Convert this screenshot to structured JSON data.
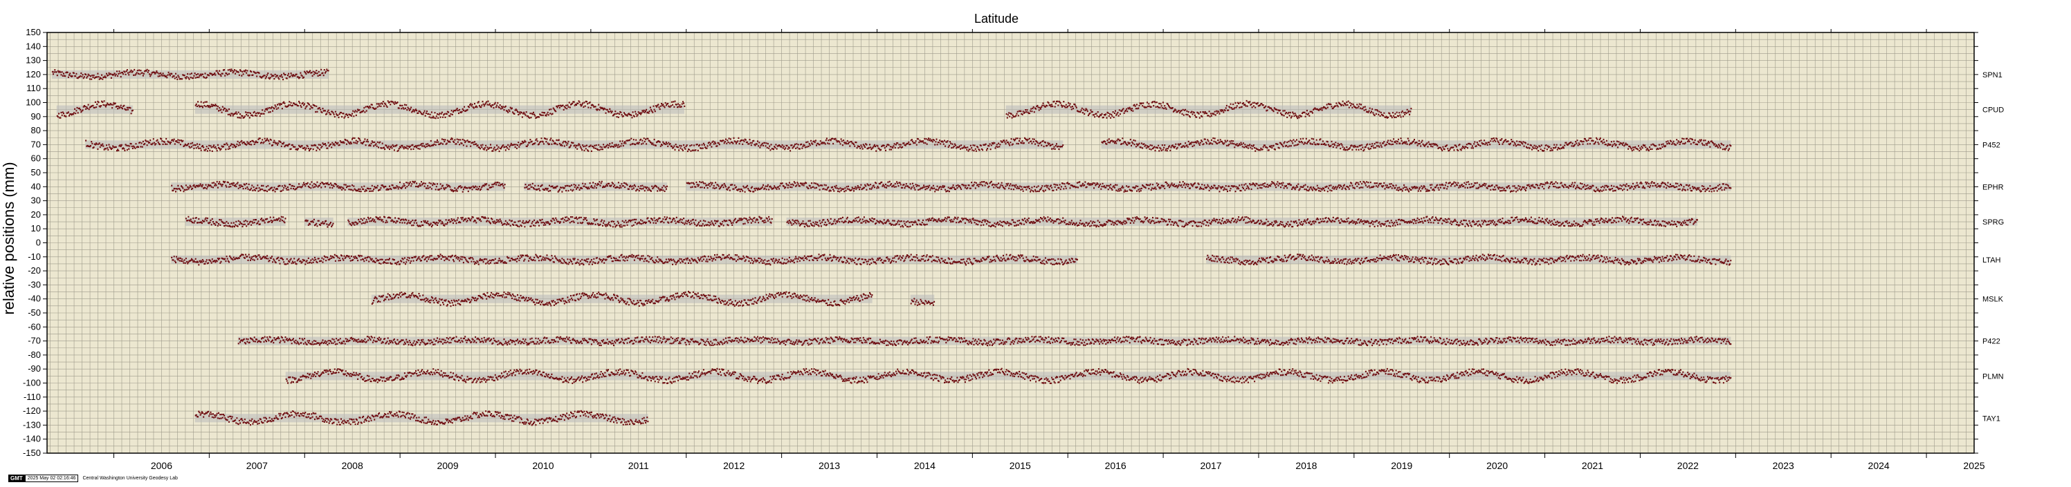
{
  "chart_data": {
    "type": "scatter",
    "title": "Latitude",
    "ylabel": "relative positions (mm)",
    "xlabel": "",
    "xlim": [
      2005.3,
      2025.5
    ],
    "ylim": [
      -150,
      150
    ],
    "ytick_step": 10,
    "xticks": [
      2006,
      2007,
      2008,
      2009,
      2010,
      2011,
      2012,
      2013,
      2014,
      2015,
      2016,
      2017,
      2018,
      2019,
      2020,
      2021,
      2022,
      2023,
      2024,
      2025
    ],
    "grid": true,
    "background_color": "#ece7d0",
    "point_color": "#6e0c10",
    "band_color": "#b9b9b9",
    "series": [
      {
        "name": "SPN1",
        "offset": 120,
        "segments": [
          [
            2005.35,
            2008.25
          ]
        ],
        "wave": 1.5
      },
      {
        "name": "CPUD",
        "offset": 95,
        "segments": [
          [
            2005.4,
            2006.2
          ],
          [
            2006.85,
            2011.98
          ],
          [
            2015.35,
            2019.6
          ]
        ],
        "wave": 4
      },
      {
        "name": "P452",
        "offset": 70,
        "segments": [
          [
            2005.7,
            2015.95
          ],
          [
            2016.35,
            2022.95
          ]
        ],
        "wave": 2.5
      },
      {
        "name": "EPHR",
        "offset": 40,
        "segments": [
          [
            2006.6,
            2010.1
          ],
          [
            2010.3,
            2011.8
          ],
          [
            2012.0,
            2022.95
          ]
        ],
        "wave": 1.5
      },
      {
        "name": "SPRG",
        "offset": 15,
        "segments": [
          [
            2006.75,
            2007.8
          ],
          [
            2008.0,
            2008.3
          ],
          [
            2008.45,
            2012.9
          ],
          [
            2013.05,
            2022.6
          ]
        ],
        "wave": 1.5
      },
      {
        "name": "LTAH",
        "offset": -12,
        "segments": [
          [
            2006.6,
            2016.1
          ],
          [
            2017.45,
            2022.95
          ]
        ],
        "wave": 1.5
      },
      {
        "name": "MSLK",
        "offset": -40,
        "segments": [
          [
            2008.7,
            2013.95
          ],
          [
            2014.35,
            2014.6
          ]
        ],
        "wave": 3
      },
      {
        "name": "P422",
        "offset": -70,
        "segments": [
          [
            2007.3,
            2022.95
          ]
        ],
        "wave": 1
      },
      {
        "name": "PLMN",
        "offset": -95,
        "segments": [
          [
            2007.8,
            2020.8
          ],
          [
            2020.8,
            2022.95
          ]
        ],
        "wave": 3
      },
      {
        "name": "TAY1",
        "offset": -125,
        "segments": [
          [
            2006.85,
            2011.6
          ]
        ],
        "wave": 3
      }
    ]
  },
  "footer": {
    "logo": "GMT",
    "timestamp": "2025 May 02 02:16:46",
    "credit": "Central Washington University Geodesy Lab"
  }
}
